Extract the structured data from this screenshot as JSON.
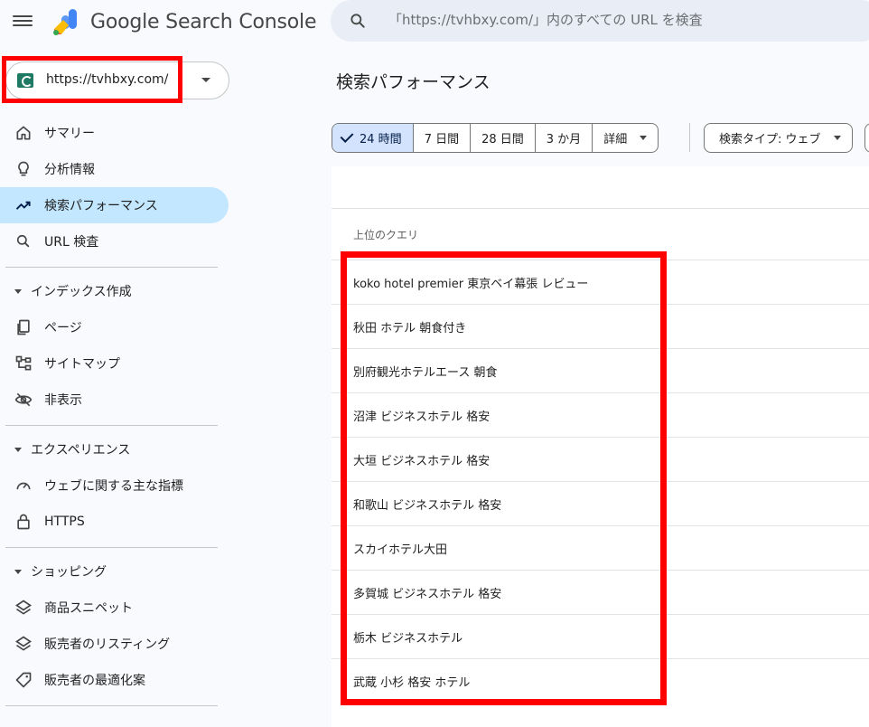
{
  "header": {
    "product_name": "Google Search Console",
    "search_placeholder": "「https://tvhbxy.com/」内のすべての URL を検査"
  },
  "property": {
    "url": "https://tvhbxy.com/"
  },
  "sidebar": {
    "items": [
      {
        "label": "サマリー",
        "icon": "home-icon"
      },
      {
        "label": "分析情報",
        "icon": "lightbulb-icon"
      },
      {
        "label": "検索パフォーマンス",
        "icon": "trending-up-icon",
        "active": true
      },
      {
        "label": "URL 検査",
        "icon": "search-icon"
      }
    ],
    "sections": [
      {
        "title": "インデックス作成",
        "items": [
          {
            "label": "ページ",
            "icon": "pages-icon"
          },
          {
            "label": "サイトマップ",
            "icon": "sitemap-icon"
          },
          {
            "label": "非表示",
            "icon": "visibility-off-icon"
          }
        ]
      },
      {
        "title": "エクスペリエンス",
        "items": [
          {
            "label": "ウェブに関する主な指標",
            "icon": "speed-icon"
          },
          {
            "label": "HTTPS",
            "icon": "lock-icon"
          }
        ]
      },
      {
        "title": "ショッピング",
        "items": [
          {
            "label": "商品スニペット",
            "icon": "layers-icon"
          },
          {
            "label": "販売者のリスティング",
            "icon": "layers-icon"
          },
          {
            "label": "販売者の最適化案",
            "icon": "tag-icon"
          }
        ]
      }
    ]
  },
  "main": {
    "title": "検索パフォーマンス",
    "date_chips": [
      "24 時間",
      "7 日間",
      "28 日間",
      "3 か月",
      "詳細"
    ],
    "selected_chip": "24 時間",
    "search_type_filter": "検索タイプ: ウェブ",
    "table": {
      "column_header": "上位のクエリ",
      "rows": [
        "koko hotel premier 東京ベイ幕張 レビュー",
        "秋田 ホテル 朝食付き",
        "別府観光ホテルエース 朝食",
        "沼津 ビジネスホテル 格安",
        "大垣 ビジネスホテル 格安",
        "和歌山 ビジネスホテル 格安",
        "スカイホテル大田",
        "多賀城 ビジネスホテル 格安",
        "栃木 ビジネスホテル",
        "武蔵 小杉 格安 ホテル"
      ]
    }
  },
  "colors": {
    "active_nav": "#c2e7ff",
    "selected_chip": "#d3e3fd",
    "highlight": "#ff0000",
    "search_bar": "#e9eef6"
  }
}
